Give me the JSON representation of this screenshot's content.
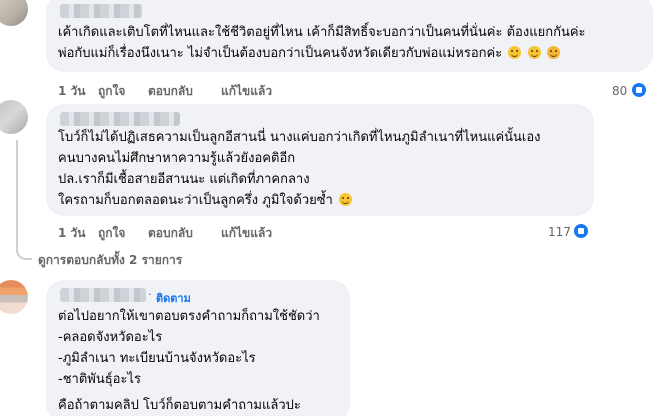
{
  "comments": [
    {
      "lines": [
        "เค้าเกิดและเติบโตที่ไหนและใช้ชีวิตอยู่ที่ไหน เค้าก็มีสิทธิ์จะบอกว่าเป็นคนที่นั่นค่ะ ต้องแยกกันค่ะ",
        "พ่อกับแม่ก็เรื่องนึงเนาะ ไม่จำเป็นต้องบอกว่าเป็นคนจังหวัดเดียวกับพ่อแม่หรอกค่ะ"
      ],
      "emojis": [
        "rolling-eyes",
        "smiling",
        "smiling-blush"
      ],
      "time": "1 วัน",
      "like_label": "ถูกใจ",
      "reply_label": "ตอบกลับ",
      "edited_label": "แก้ไขแล้ว",
      "reaction_count": "80"
    },
    {
      "lines": [
        "โบว์ก็ไม่ได้ปฏิเสธความเป็นลูกอีสานนี่ นางแค่บอกว่าเกิดที่ไหนภูมิลำเนาที่ไหนแค่นั้นเอง",
        "คนบางคนไม่ศึกษาหาความรู้แล้วยังอคติอีก",
        "ปล.เราก็มีเชื้อสายอีสานนะ แต่เกิดที่ภาคกลาง",
        "ใครถามก็บอกตลอดนะว่าเป็นลูกครึ่ง ภูมิใจด้วยซ้ำ"
      ],
      "emojis": [
        "grinning"
      ],
      "time": "1 วัน",
      "like_label": "ถูกใจ",
      "reply_label": "ตอบกลับ",
      "edited_label": "แก้ไขแล้ว",
      "reaction_count": "117"
    },
    {
      "follow_label": "ติดตาม",
      "follow_dot": "·",
      "lines": [
        "ต่อไปอยากให้เขาตอบตรงคำถามก็ถามใช้ชัดว่า",
        "-คลอดจังหวัดอะไร",
        "-ภูมิลำเนา ทะเบียนบ้านจังหวัดอะไร",
        "-ชาติพันธุ์อะไร",
        "",
        "คือถ้าตามคลิป โบว์ก็ตอบตามคำถามแล้วปะ"
      ]
    }
  ],
  "view_replies_label": "ดูการตอบกลับทั้ง 2 รายการ",
  "colors": {
    "bubble": "#f0f2f5",
    "link": "#1877f2",
    "muted": "#65676b"
  }
}
